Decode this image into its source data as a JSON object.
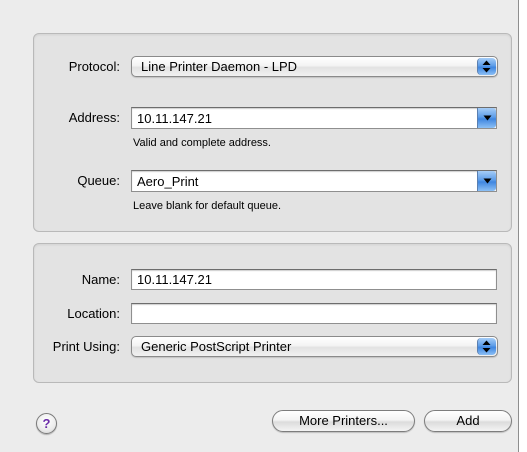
{
  "connection": {
    "protocol_label": "Protocol:",
    "protocol_value": "Line Printer Daemon - LPD",
    "address_label": "Address:",
    "address_value": "10.11.147.21",
    "address_hint": "Valid and complete address.",
    "queue_label": "Queue:",
    "queue_value": "Aero_Print",
    "queue_hint": "Leave blank for default queue."
  },
  "printer": {
    "name_label": "Name:",
    "name_value": "10.11.147.21",
    "location_label": "Location:",
    "location_value": "",
    "print_using_label": "Print Using:",
    "print_using_value": "Generic PostScript Printer"
  },
  "footer": {
    "help_glyph": "?",
    "more_printers_label": "More Printers...",
    "add_label": "Add"
  },
  "icons": {
    "popup_arrows": "up-down-arrows-icon",
    "combo_arrow": "down-arrow-icon",
    "help": "help-icon"
  },
  "colors": {
    "accent_blue": "#5e9de8",
    "window_bg": "#ececec",
    "help_mark": "#6a2ca8"
  }
}
